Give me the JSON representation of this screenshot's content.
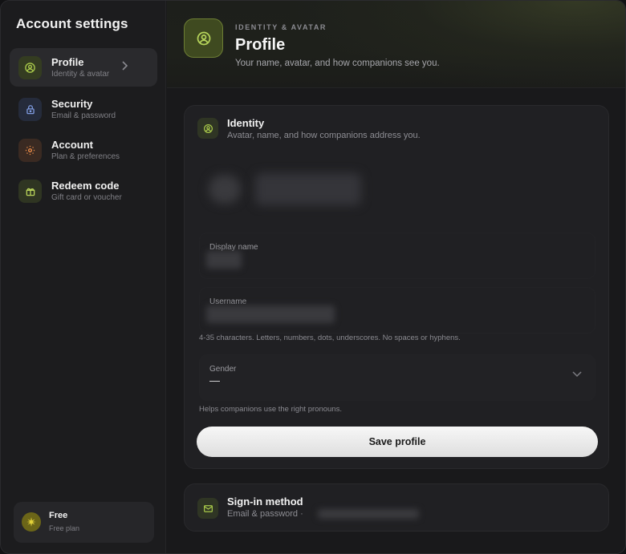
{
  "sidebar": {
    "title": "Account settings",
    "items": [
      {
        "label": "Profile",
        "sub": "Identity & avatar",
        "icon": "user-circle-icon",
        "active": true
      },
      {
        "label": "Security",
        "sub": "Email & password",
        "icon": "lock-icon",
        "active": false
      },
      {
        "label": "Account",
        "sub": "Plan & preferences",
        "icon": "gear-icon",
        "active": false
      },
      {
        "label": "Redeem code",
        "sub": "Gift card or voucher",
        "icon": "gift-icon",
        "active": false
      }
    ],
    "plan": {
      "title": "Free",
      "sub": "Free plan",
      "icon": "sparkle-icon"
    }
  },
  "header": {
    "eyebrow": "IDENTITY & AVATAR",
    "title": "Profile",
    "subtitle": "Your name, avatar, and how companions see you.",
    "icon": "user-circle-icon"
  },
  "identity": {
    "title": "Identity",
    "subtitle": "Avatar, name, and how companions address you.",
    "display_name_label": "Display name",
    "username_label": "Username",
    "username_hint": "4-35 characters. Letters, numbers, dots, underscores. No spaces or hyphens.",
    "gender_label": "Gender",
    "gender_value": "—",
    "gender_hint": "Helps companions use the right pronouns.",
    "save_label": "Save profile"
  },
  "signin": {
    "title": "Sign-in method",
    "subtitle": "Email & password ·",
    "icon": "mail-icon"
  },
  "colors": {
    "accent": "#a7c74a",
    "security": "#6f8fd8",
    "account": "#e07a3e",
    "gift": "#b9d45a",
    "plan": "#e3d23a"
  }
}
